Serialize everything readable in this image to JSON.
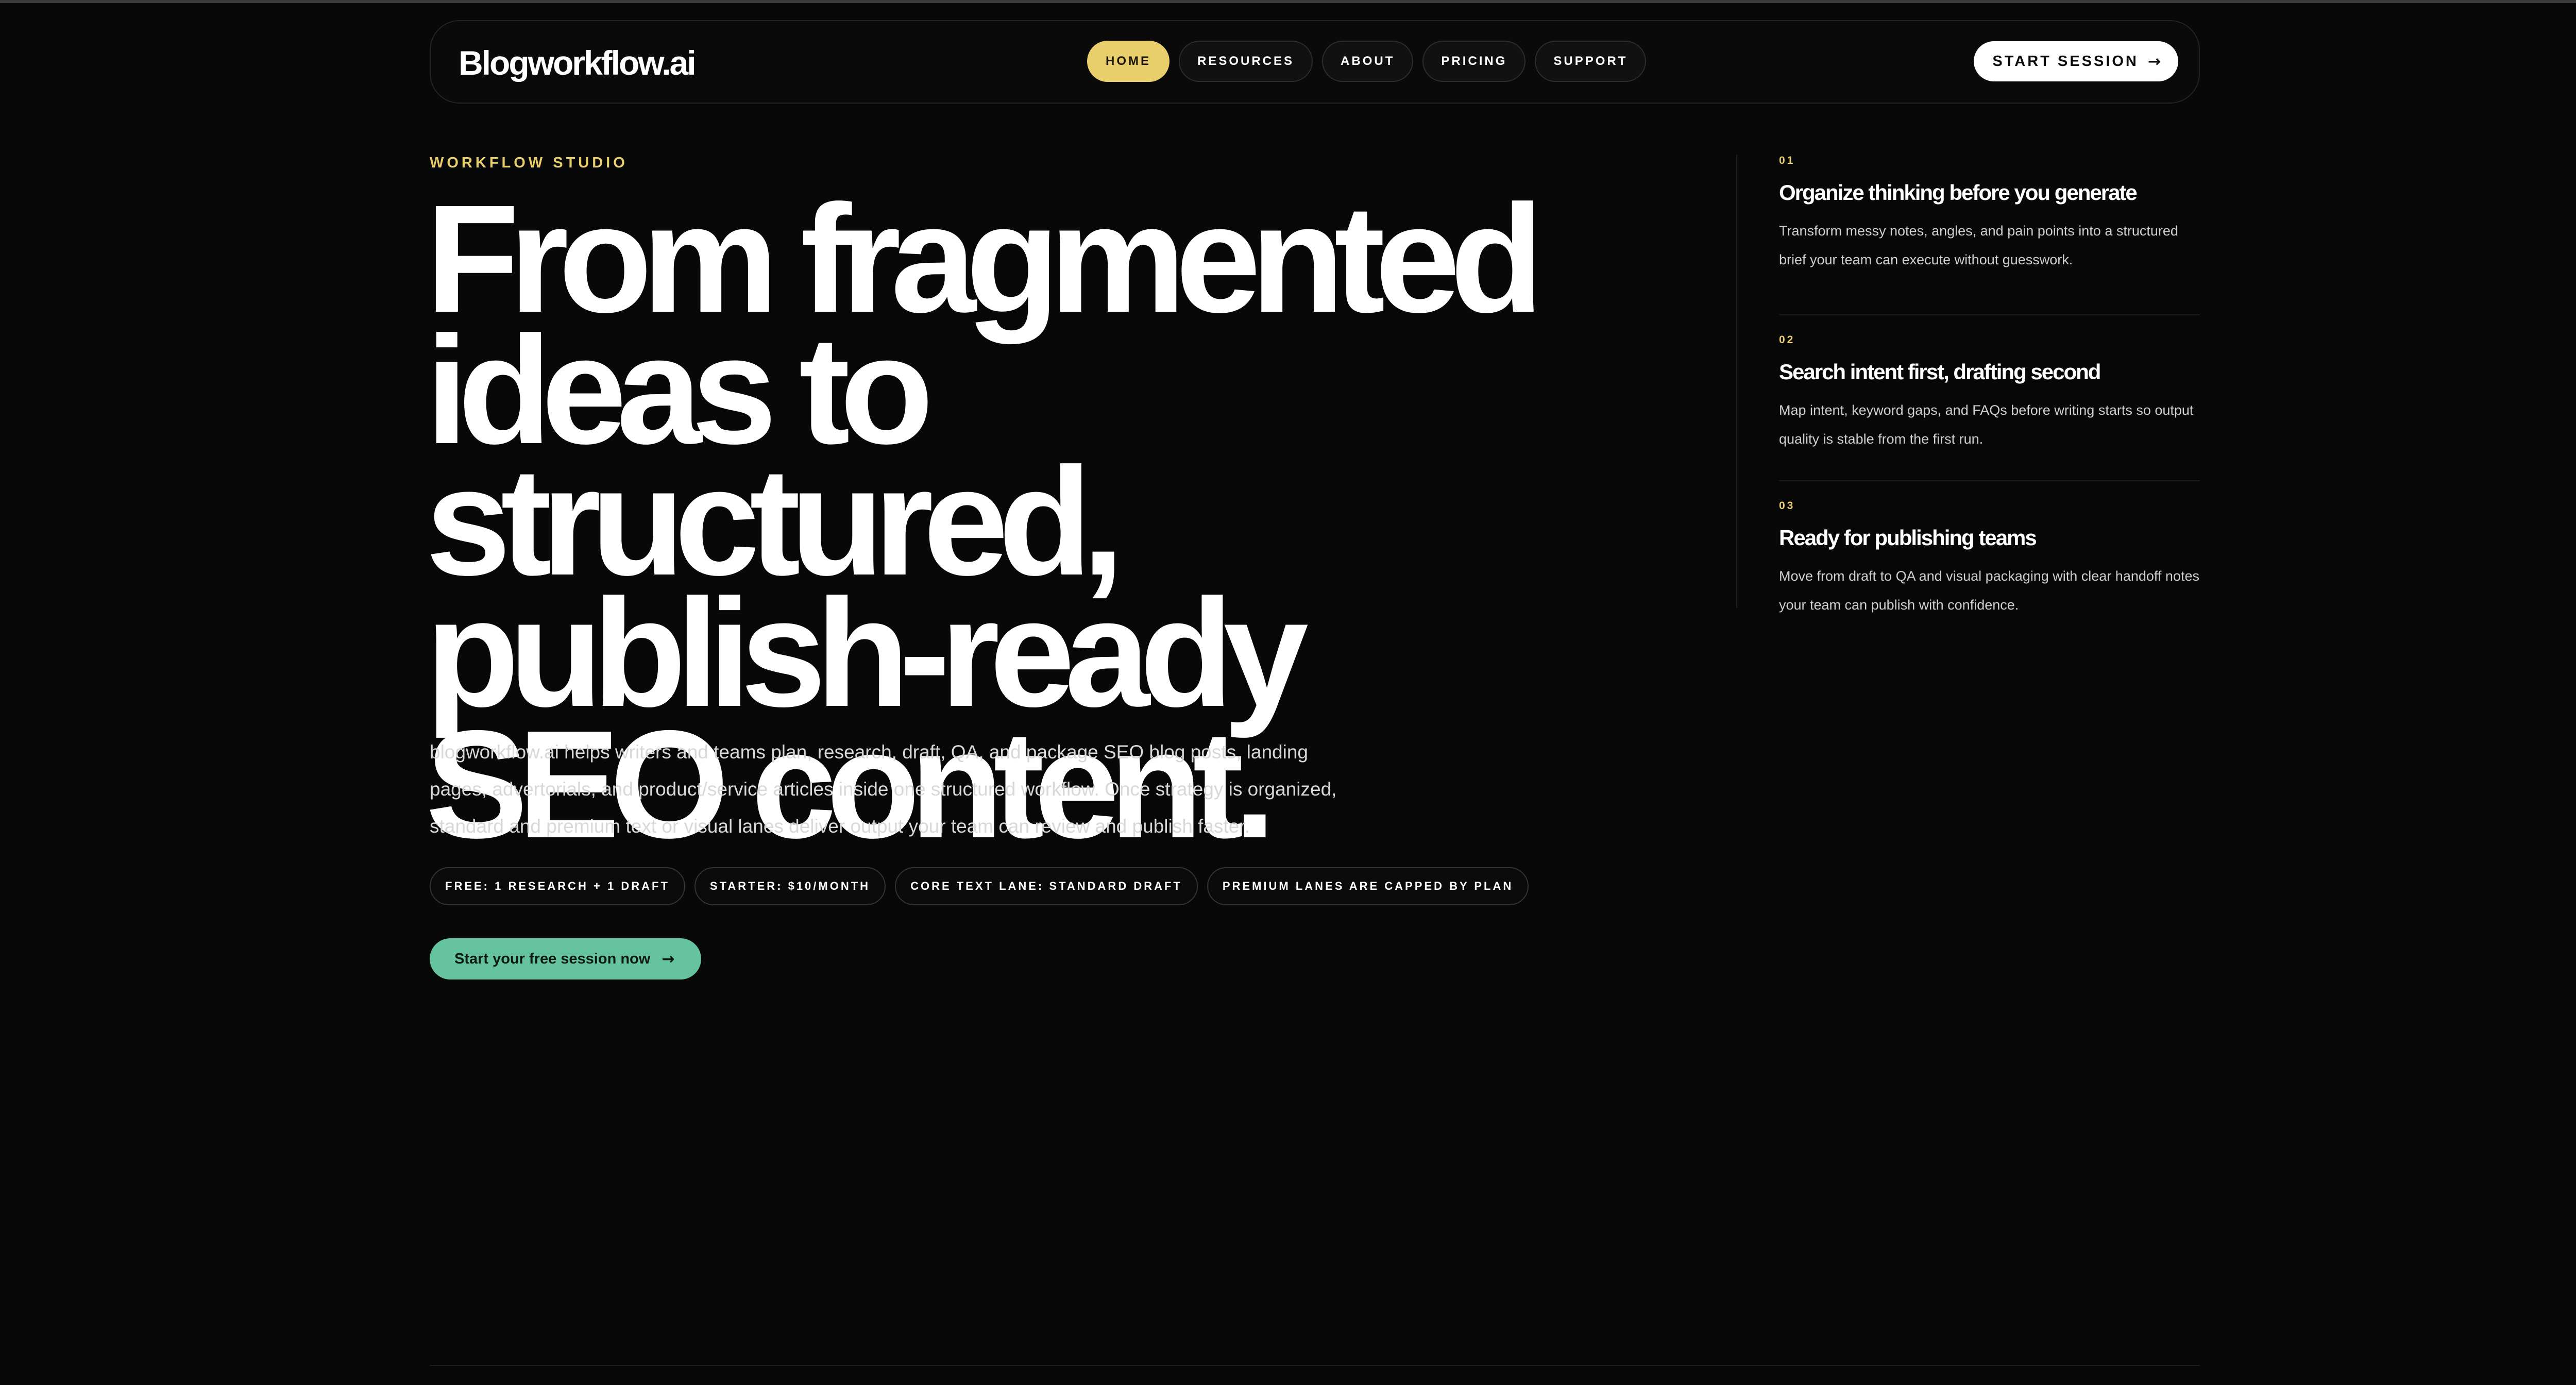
{
  "nav": {
    "brand": "Blogworkflow.ai",
    "links": [
      {
        "label": "HOME",
        "active": true
      },
      {
        "label": "RESOURCES",
        "active": false
      },
      {
        "label": "ABOUT",
        "active": false
      },
      {
        "label": "PRICING",
        "active": false
      },
      {
        "label": "SUPPORT",
        "active": false
      }
    ],
    "cta_label": "START SESSION",
    "cta_icon": "arrow-right-icon"
  },
  "hero": {
    "eyebrow": "WORKFLOW STUDIO",
    "headline": "From fragmented ideas to structured, publish-ready SEO content.",
    "lede": "blogworkflow.ai helps writers and teams plan, research, draft, QA, and package SEO blog posts, landing pages, advertorials, and product/service articles inside one structured workflow. Once strategy is organized, standard and premium text or visual lanes deliver output your team can review and publish faster.",
    "chips": [
      "FREE: 1 RESEARCH + 1 DRAFT",
      "STARTER: $10/MONTH",
      "CORE TEXT LANE: STANDARD DRAFT",
      "PREMIUM LANES ARE CAPPED BY PLAN"
    ],
    "cta_label": "Start your free session now",
    "cta_icon": "arrow-right-icon"
  },
  "features": [
    {
      "number": "01",
      "title": "Organize thinking before you generate",
      "body": "Transform messy notes, angles, and pain points into a structured brief your team can execute without guesswork."
    },
    {
      "number": "02",
      "title": "Search intent first, drafting second",
      "body": "Map intent, keyword gaps, and FAQs before writing starts so output quality is stable from the first run."
    },
    {
      "number": "03",
      "title": "Ready for publishing teams",
      "body": "Move from draft to QA and visual packaging with clear handoff notes your team can publish with confidence."
    }
  ],
  "colors": {
    "background": "#080808",
    "accent_yellow": "#e9ce6c",
    "accent_green": "#66c3a0"
  }
}
